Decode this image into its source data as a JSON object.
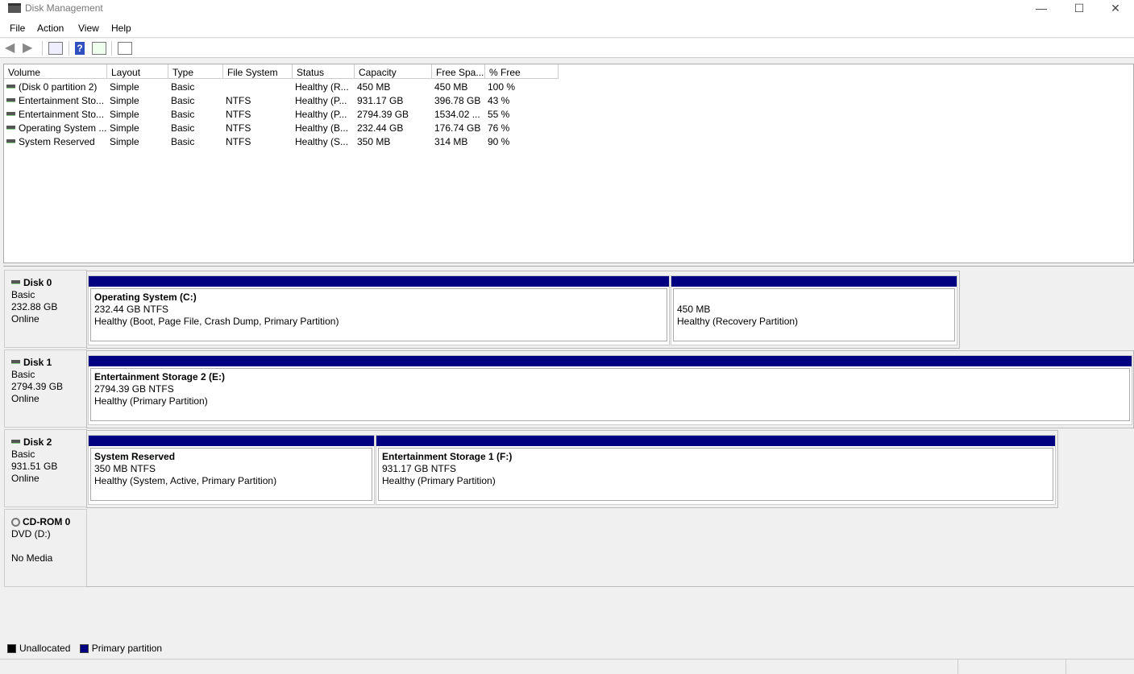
{
  "window": {
    "title": "Disk Management",
    "minimize": "—",
    "maximize": "☐",
    "close": "✕"
  },
  "menu": [
    "File",
    "Action",
    "View",
    "Help"
  ],
  "columns": [
    "Volume",
    "Layout",
    "Type",
    "File System",
    "Status",
    "Capacity",
    "Free Spa...",
    "% Free"
  ],
  "volumes": [
    [
      "(Disk 0 partition 2)",
      "Simple",
      "Basic",
      "",
      "Healthy (R...",
      "450 MB",
      "450 MB",
      "100 %"
    ],
    [
      "Entertainment Sto...",
      "Simple",
      "Basic",
      "NTFS",
      "Healthy (P...",
      "931.17 GB",
      "396.78 GB",
      "43 %"
    ],
    [
      "Entertainment Sto...",
      "Simple",
      "Basic",
      "NTFS",
      "Healthy (P...",
      "2794.39 GB",
      "1534.02 ...",
      "55 %"
    ],
    [
      "Operating System ...",
      "Simple",
      "Basic",
      "NTFS",
      "Healthy (B...",
      "232.44 GB",
      "176.74 GB",
      "76 %"
    ],
    [
      "System Reserved",
      "Simple",
      "Basic",
      "NTFS",
      "Healthy (S...",
      "350 MB",
      "314 MB",
      "90 %"
    ]
  ],
  "disks": [
    {
      "name": "Disk 0",
      "type": "Basic",
      "size": "232.88 GB",
      "state": "Online",
      "partitions": [
        {
          "name": "Operating System  (C:)",
          "size": "232.44 GB NTFS",
          "status": "Healthy (Boot, Page File, Crash Dump, Primary Partition)"
        },
        {
          "name": "",
          "size": "450 MB",
          "status": "Healthy (Recovery Partition)"
        }
      ]
    },
    {
      "name": "Disk 1",
      "type": "Basic",
      "size": "2794.39 GB",
      "state": "Online",
      "partitions": [
        {
          "name": "Entertainment Storage 2  (E:)",
          "size": "2794.39 GB NTFS",
          "status": "Healthy (Primary Partition)"
        }
      ]
    },
    {
      "name": "Disk 2",
      "type": "Basic",
      "size": "931.51 GB",
      "state": "Online",
      "partitions": [
        {
          "name": "System Reserved",
          "size": "350 MB NTFS",
          "status": "Healthy (System, Active, Primary Partition)"
        },
        {
          "name": "Entertainment Storage 1  (F:)",
          "size": "931.17 GB NTFS",
          "status": "Healthy (Primary Partition)"
        }
      ]
    }
  ],
  "cdrom": {
    "name": "CD-ROM 0",
    "type": "DVD (D:)",
    "state": "No Media"
  },
  "legend": {
    "unallocated": "Unallocated",
    "primary": "Primary partition",
    "unallocated_color": "#000000",
    "primary_color": "#000080"
  }
}
